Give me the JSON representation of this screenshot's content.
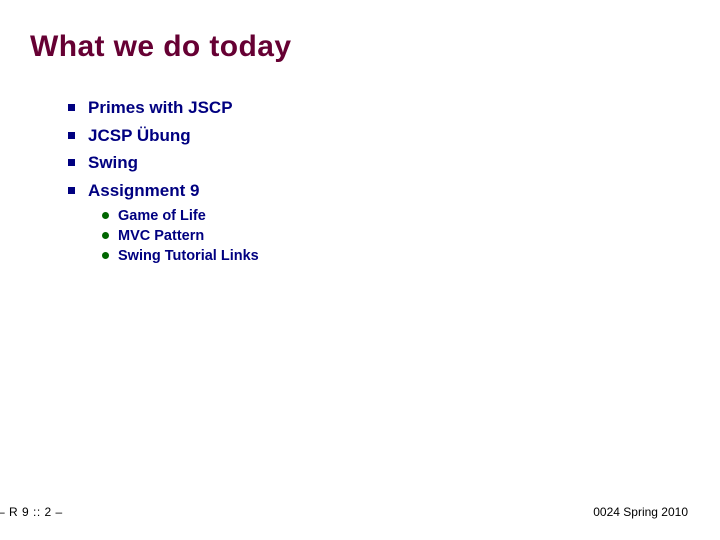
{
  "slide": {
    "title": "What we do today",
    "bullets": [
      {
        "label": "Primes with JSCP"
      },
      {
        "label": "JCSP Übung"
      },
      {
        "label": "Swing"
      },
      {
        "label": "Assignment 9",
        "sub": [
          {
            "label": "Game of Life"
          },
          {
            "label": "MVC Pattern"
          },
          {
            "label": "Swing Tutorial Links"
          }
        ]
      }
    ],
    "footer_left": "– R 9 :: 2 –",
    "footer_right": "0024 Spring 2010",
    "colors": {
      "title": "#660033",
      "body_text": "#000080",
      "level1_bullet": "#000080",
      "level2_bullet": "#006600",
      "background": "#ffffff"
    }
  }
}
